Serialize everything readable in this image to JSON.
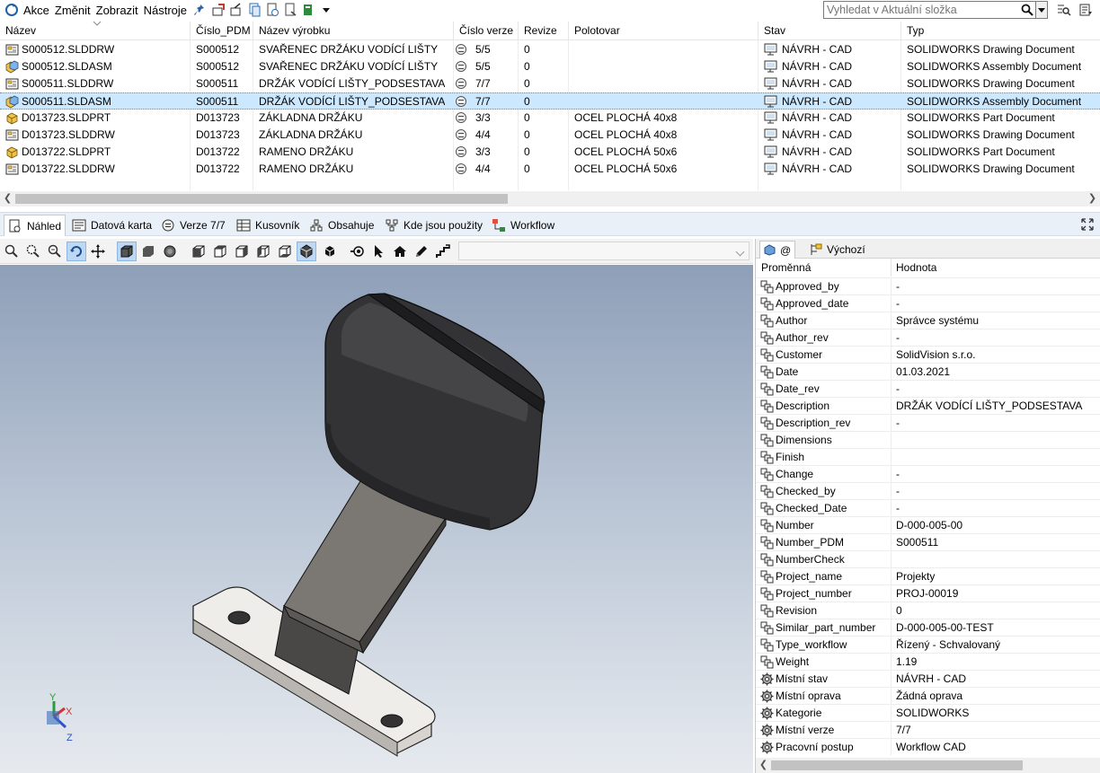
{
  "menu": {
    "items": [
      "Akce",
      "Změnit",
      "Zobrazit",
      "Nástroje"
    ],
    "toolbar_icons": [
      "pin-icon",
      "check-out-icon",
      "check-in-icon",
      "copy-tree-icon",
      "get-version-icon",
      "undo-checkout-icon",
      "change-state-icon",
      "dropdown-arrow-icon"
    ]
  },
  "search": {
    "placeholder": "Vyhledat v Aktuální složka"
  },
  "file_list": {
    "columns": [
      "Název",
      "Číslo_PDM",
      "Název výrobku",
      "Číslo verze",
      "Revize",
      "Polotovar",
      "Stav",
      "Typ"
    ],
    "rows": [
      {
        "name": "S000512.SLDDRW",
        "pdm": "S000512",
        "product": "SVAŘENEC DRŽÁKU VODÍCÍ LIŠTY",
        "version": "5/5",
        "revision": "0",
        "stock": "",
        "state": "NÁVRH - CAD",
        "type": "SOLIDWORKS Drawing Document",
        "kind": "drawing"
      },
      {
        "name": "S000512.SLDASM",
        "pdm": "S000512",
        "product": "SVAŘENEC DRŽÁKU VODÍCÍ LIŠTY",
        "version": "5/5",
        "revision": "0",
        "stock": "",
        "state": "NÁVRH - CAD",
        "type": "SOLIDWORKS Assembly Document",
        "kind": "assembly"
      },
      {
        "name": "S000511.SLDDRW",
        "pdm": "S000511",
        "product": "DRŽÁK VODÍCÍ LIŠTY_PODSESTAVA",
        "version": "7/7",
        "revision": "0",
        "stock": "",
        "state": "NÁVRH - CAD",
        "type": "SOLIDWORKS Drawing Document",
        "kind": "drawing"
      },
      {
        "name": "S000511.SLDASM",
        "pdm": "S000511",
        "product": "DRŽÁK VODÍCÍ LIŠTY_PODSESTAVA",
        "version": "7/7",
        "revision": "0",
        "stock": "",
        "state": "NÁVRH - CAD",
        "type": "SOLIDWORKS Assembly Document",
        "kind": "assembly",
        "selected": true
      },
      {
        "name": "D013723.SLDPRT",
        "pdm": "D013723",
        "product": "ZÁKLADNA DRŽÁKU",
        "version": "3/3",
        "revision": "0",
        "stock": "OCEL PLOCHÁ 40x8",
        "state": "NÁVRH - CAD",
        "type": "SOLIDWORKS Part Document",
        "kind": "part"
      },
      {
        "name": "D013723.SLDDRW",
        "pdm": "D013723",
        "product": "ZÁKLADNA DRŽÁKU",
        "version": "4/4",
        "revision": "0",
        "stock": "OCEL PLOCHÁ 40x8",
        "state": "NÁVRH - CAD",
        "type": "SOLIDWORKS Drawing Document",
        "kind": "drawing"
      },
      {
        "name": "D013722.SLDPRT",
        "pdm": "D013722",
        "product": "RAMENO DRŽÁKU",
        "version": "3/3",
        "revision": "0",
        "stock": "OCEL PLOCHÁ 50x6",
        "state": "NÁVRH - CAD",
        "type": "SOLIDWORKS Part Document",
        "kind": "part"
      },
      {
        "name": "D013722.SLDDRW",
        "pdm": "D013722",
        "product": "RAMENO DRŽÁKU",
        "version": "4/4",
        "revision": "0",
        "stock": "OCEL PLOCHÁ 50x6",
        "state": "NÁVRH - CAD",
        "type": "SOLIDWORKS Drawing Document",
        "kind": "drawing"
      }
    ]
  },
  "tabs": [
    {
      "label": "Náhled",
      "icon": "preview-icon",
      "active": true
    },
    {
      "label": "Datová karta",
      "icon": "data-card-icon"
    },
    {
      "label": "Verze 7/7",
      "icon": "version-icon"
    },
    {
      "label": "Kusovník",
      "icon": "bom-icon"
    },
    {
      "label": "Obsahuje",
      "icon": "contains-icon"
    },
    {
      "label": "Kde jsou použity",
      "icon": "where-used-icon"
    },
    {
      "label": "Workflow",
      "icon": "workflow-icon"
    }
  ],
  "viewer": {
    "tools": [
      "zoom-icon",
      "zoom-to-area-icon",
      "zoom-to-fit-icon",
      "rotate-icon",
      "pan-icon",
      "shaded-with-edges-icon",
      "shaded-icon",
      "wireframe-icon",
      "front-view-icon",
      "back-view-icon",
      "left-view-icon",
      "right-view-icon",
      "top-view-icon",
      "isometric-view-icon",
      "explode-icon",
      "select-icon",
      "home-view-icon",
      "measure-icon",
      "section-icon"
    ],
    "triad": {
      "x": "X",
      "y": "Y",
      "z": "Z"
    },
    "colors": {
      "body": "#3c3c3f",
      "arm": "#6f6c68",
      "base": "#e8e6e2"
    }
  },
  "properties": {
    "tabs": [
      "@",
      "Výchozí"
    ],
    "header_name": "Proměnná",
    "header_value": "Hodnota",
    "rows": [
      {
        "name": "Approved_by",
        "value": "-",
        "icon": "variable-icon"
      },
      {
        "name": "Approved_date",
        "value": "-",
        "icon": "variable-icon"
      },
      {
        "name": "Author",
        "value": "Správce systému",
        "icon": "variable-icon"
      },
      {
        "name": "Author_rev",
        "value": "-",
        "icon": "variable-icon"
      },
      {
        "name": "Customer",
        "value": "SolidVision s.r.o.",
        "icon": "variable-icon"
      },
      {
        "name": "Date",
        "value": "01.03.2021",
        "icon": "variable-icon"
      },
      {
        "name": "Date_rev",
        "value": "-",
        "icon": "variable-icon"
      },
      {
        "name": "Description",
        "value": "DRŽÁK VODÍCÍ LIŠTY_PODSESTAVA",
        "icon": "variable-icon"
      },
      {
        "name": "Description_rev",
        "value": "-",
        "icon": "variable-icon"
      },
      {
        "name": "Dimensions",
        "value": "",
        "icon": "variable-icon"
      },
      {
        "name": "Finish",
        "value": "",
        "icon": "variable-icon"
      },
      {
        "name": "Change",
        "value": "-",
        "icon": "variable-icon"
      },
      {
        "name": "Checked_by",
        "value": "-",
        "icon": "variable-icon"
      },
      {
        "name": "Checked_Date",
        "value": "-",
        "icon": "variable-icon"
      },
      {
        "name": "Number",
        "value": "D-000-005-00",
        "icon": "variable-icon"
      },
      {
        "name": "Number_PDM",
        "value": "S000511",
        "icon": "variable-icon"
      },
      {
        "name": "NumberCheck",
        "value": "",
        "icon": "variable-icon"
      },
      {
        "name": "Project_name",
        "value": "Projekty",
        "icon": "variable-icon"
      },
      {
        "name": "Project_number",
        "value": "PROJ-00019",
        "icon": "variable-icon"
      },
      {
        "name": "Revision",
        "value": "0",
        "icon": "variable-icon"
      },
      {
        "name": "Similar_part_number",
        "value": "D-000-005-00-TEST",
        "icon": "variable-icon"
      },
      {
        "name": "Type_workflow",
        "value": "Řízený - Schvalovaný",
        "icon": "variable-icon"
      },
      {
        "name": "Weight",
        "value": "1.19",
        "icon": "variable-icon"
      },
      {
        "name": "Místní stav",
        "value": "NÁVRH - CAD",
        "icon": "system-variable-icon"
      },
      {
        "name": "Místní oprava",
        "value": "Žádná oprava",
        "icon": "system-variable-icon"
      },
      {
        "name": "Kategorie",
        "value": "SOLIDWORKS",
        "icon": "system-variable-icon"
      },
      {
        "name": "Místní verze",
        "value": "7/7",
        "icon": "system-variable-icon"
      },
      {
        "name": "Pracovní postup",
        "value": "Workflow CAD",
        "icon": "system-variable-icon"
      }
    ]
  }
}
